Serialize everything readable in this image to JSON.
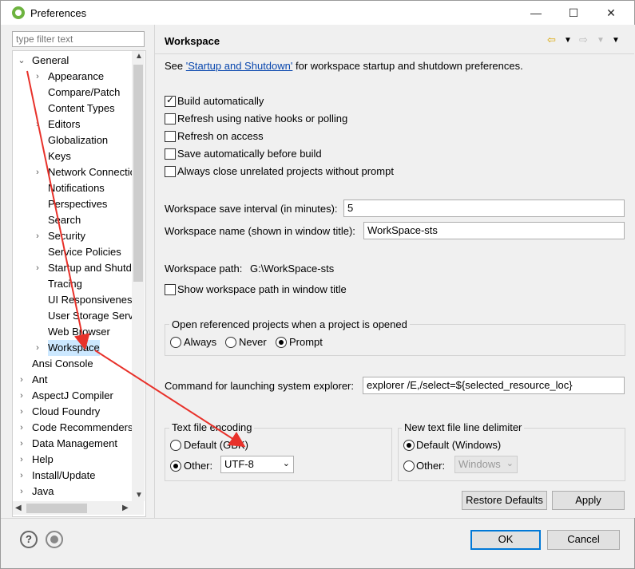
{
  "window": {
    "title": "Preferences",
    "minimize_glyph": "—",
    "maximize_glyph": "☐",
    "close_glyph": "✕"
  },
  "filter": {
    "placeholder": "type filter text"
  },
  "tree": {
    "items": [
      {
        "label": "General",
        "twisty": "v",
        "indent": 0
      },
      {
        "label": "Appearance",
        "twisty": ">",
        "indent": 1
      },
      {
        "label": "Compare/Patch",
        "twisty": "",
        "indent": 1
      },
      {
        "label": "Content Types",
        "twisty": "",
        "indent": 1
      },
      {
        "label": "Editors",
        "twisty": ">",
        "indent": 1
      },
      {
        "label": "Globalization",
        "twisty": "",
        "indent": 1
      },
      {
        "label": "Keys",
        "twisty": "",
        "indent": 1
      },
      {
        "label": "Network Connectio",
        "twisty": ">",
        "indent": 1
      },
      {
        "label": "Notifications",
        "twisty": "",
        "indent": 1
      },
      {
        "label": "Perspectives",
        "twisty": "",
        "indent": 1
      },
      {
        "label": "Search",
        "twisty": "",
        "indent": 1
      },
      {
        "label": "Security",
        "twisty": ">",
        "indent": 1
      },
      {
        "label": "Service Policies",
        "twisty": "",
        "indent": 1
      },
      {
        "label": "Startup and Shutd",
        "twisty": ">",
        "indent": 1
      },
      {
        "label": "Tracing",
        "twisty": "",
        "indent": 1
      },
      {
        "label": "UI Responsiveness",
        "twisty": "",
        "indent": 1
      },
      {
        "label": "User Storage Serv",
        "twisty": "",
        "indent": 1
      },
      {
        "label": "Web Browser",
        "twisty": "",
        "indent": 1
      },
      {
        "label": "Workspace",
        "twisty": ">",
        "indent": 1,
        "selected": true
      },
      {
        "label": "Ansi Console",
        "twisty": "",
        "indent": 0
      },
      {
        "label": "Ant",
        "twisty": ">",
        "indent": 0
      },
      {
        "label": "AspectJ Compiler",
        "twisty": ">",
        "indent": 0
      },
      {
        "label": "Cloud Foundry",
        "twisty": ">",
        "indent": 0
      },
      {
        "label": "Code Recommenders",
        "twisty": ">",
        "indent": 0
      },
      {
        "label": "Data Management",
        "twisty": ">",
        "indent": 0
      },
      {
        "label": "Help",
        "twisty": ">",
        "indent": 0
      },
      {
        "label": "Install/Update",
        "twisty": ">",
        "indent": 0
      },
      {
        "label": "Java",
        "twisty": ">",
        "indent": 0
      }
    ]
  },
  "page": {
    "heading": "Workspace",
    "see_prefix": "See ",
    "see_link": "'Startup and Shutdown'",
    "see_suffix": " for workspace startup and shutdown preferences.",
    "checkboxes": [
      {
        "label": "Build automatically",
        "checked": true
      },
      {
        "label": "Refresh using native hooks or polling",
        "checked": false
      },
      {
        "label": "Refresh on access",
        "checked": false
      },
      {
        "label": "Save automatically before build",
        "checked": false
      },
      {
        "label": "Always close unrelated projects without prompt",
        "checked": false
      }
    ],
    "save_interval_label": "Workspace save interval (in minutes):",
    "save_interval_value": "5",
    "workspace_name_label": "Workspace name (shown in window title):",
    "workspace_name_value": "WorkSpace-sts",
    "workspace_path_label": "Workspace path:",
    "workspace_path_value": "G:\\WorkSpace-sts",
    "show_path_label": "Show workspace path in window title",
    "open_ref_group": "Open referenced projects when a project is opened",
    "open_ref_options": [
      "Always",
      "Never",
      "Prompt"
    ],
    "open_ref_selected": "Prompt",
    "command_label": "Command for launching system explorer:",
    "command_value": "explorer /E,/select=${selected_resource_loc}",
    "encoding_group": "Text file encoding",
    "encoding_default": "Default (GBK)",
    "encoding_other": "Other:",
    "encoding_value": "UTF-8",
    "delimiter_group": "New text file line delimiter",
    "delimiter_default": "Default (Windows)",
    "delimiter_other": "Other:",
    "delimiter_value": "Windows",
    "restore_defaults": "Restore Defaults",
    "apply": "Apply"
  },
  "footer": {
    "help_glyph": "?",
    "ok": "OK",
    "cancel": "Cancel"
  },
  "colors": {
    "annotation_arrow": "#e8312a",
    "selection": "#cce8ff",
    "default_button_border": "#0078d7"
  }
}
